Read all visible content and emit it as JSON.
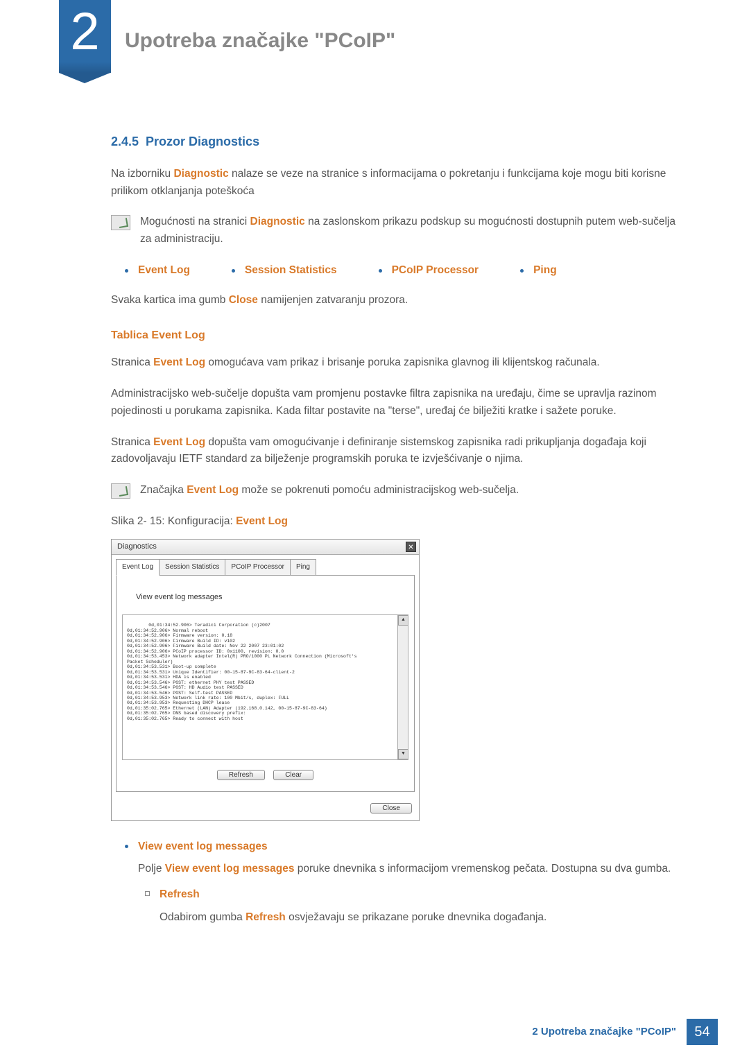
{
  "chapter": {
    "number": "2",
    "title": "Upotreba značajke \"PCoIP\""
  },
  "section": {
    "number": "2.4.5",
    "title": "Prozor Diagnostics"
  },
  "intro_text": "Na izborniku ",
  "intro_highlight": "Diagnostic",
  "intro_rest": " nalaze se veze na stranice s informacijama o pokretanju i funkcijama koje mogu biti korisne prilikom otklanjanja poteškoća",
  "note1_pre": "Mogućnosti na stranici ",
  "note1_hl": "Diagnostic",
  "note1_post": " na zaslonskom prikazu podskup su mogućnosti dostupnih putem web-sučelja za administraciju.",
  "tabs": [
    "Event Log",
    "Session Statistics",
    "PCoIP Processor",
    "Ping"
  ],
  "close_sentence_pre": "Svaka kartica ima gumb ",
  "close_sentence_hl": "Close",
  "close_sentence_post": " namijenjen zatvaranju prozora.",
  "tablica_heading": "Tablica Event Log",
  "p1_pre": "Stranica ",
  "p1_hl": "Event Log",
  "p1_post": " omogućava vam prikaz i brisanje poruka zapisnika glavnog ili klijentskog računala.",
  "p2": "Administracijsko web-sučelje dopušta vam promjenu postavke filtra zapisnika na uređaju, čime se upravlja razinom pojedinosti u porukama zapisnika. Kada filtar postavite na \"terse\", uređaj će bilježiti kratke i sažete poruke.",
  "p3_pre": "Stranica ",
  "p3_hl": "Event Log",
  "p3_post": " dopušta vam omogućivanje i definiranje sistemskog zapisnika radi prikupljanja događaja koji zadovoljavaju IETF standard za bilježenje programskih poruka te izvješćivanje o njima.",
  "note2_pre": "Značajka ",
  "note2_hl": "Event Log",
  "note2_post": " može se pokrenuti pomoću administracijskog web-sučelja.",
  "figure_pre": "Slika 2- 15: Konfiguracija: ",
  "figure_hl": "Event Log",
  "diag": {
    "title": "Diagnostics",
    "tabs": [
      "Event Log",
      "Session Statistics",
      "PCoIP Processor",
      "Ping"
    ],
    "heading": "View event log messages",
    "log": "0d,01:34:52.906> Teradici Corporation (c)2007\n0d,01:34:52.906> Normal reboot\n0d,01:34:52.906> Firmware version: 0.18\n0d,01:34:52.906> Firmware Build ID: v102\n0d,01:34:52.906> Firmware Build date: Nov 22 2007 23:01:02\n0d,01:34:52.906> PCoIP processor ID: 0x1100, revision: 0.0\n0d,01:34:53.453> Network adapter Intel(R) PRO/1000 PL Network Connection (Microsoft's\nPacket Scheduler)\n0d,01:34:53.531> Boot-up complete\n0d,01:34:53.531> Unique Identifier: 00-15-87-9C-83-64-client-2\n0d,01:34:53.531> HDA is enabled\n0d,01:34:53.546> POST: ethernet PHY test PASSED\n0d,01:34:53.546> POST: HD Audio test PASSED\n0d,01:34:53.546> POST: Self-test PASSED\n0d,01:34:53.953> Network link rate: 100 Mbit/s, duplex: FULL\n0d,01:34:53.953> Requesting DHCP lease\n0d,01:35:02.765> Ethernet (LAN) Adapter (192.168.0.142, 00-15-87-9C-83-64)\n0d,01:35:02.765> DNS based discovery prefix:\n0d,01:35:02.765> Ready to connect with host",
    "refresh": "Refresh",
    "clear": "Clear",
    "close": "Close"
  },
  "velm": {
    "title": "View event log messages",
    "text_pre": "Polje ",
    "text_hl": "View event log messages",
    "text_post": " poruke dnevnika s informacijom vremenskog pečata. Dostupna su dva gumba."
  },
  "refresh": {
    "title": "Refresh",
    "text_pre": "Odabirom gumba ",
    "text_hl": "Refresh",
    "text_post": " osvježavaju se prikazane poruke dnevnika događanja."
  },
  "footer": {
    "text": "2 Upotreba značajke \"PCoIP\"",
    "page": "54"
  }
}
